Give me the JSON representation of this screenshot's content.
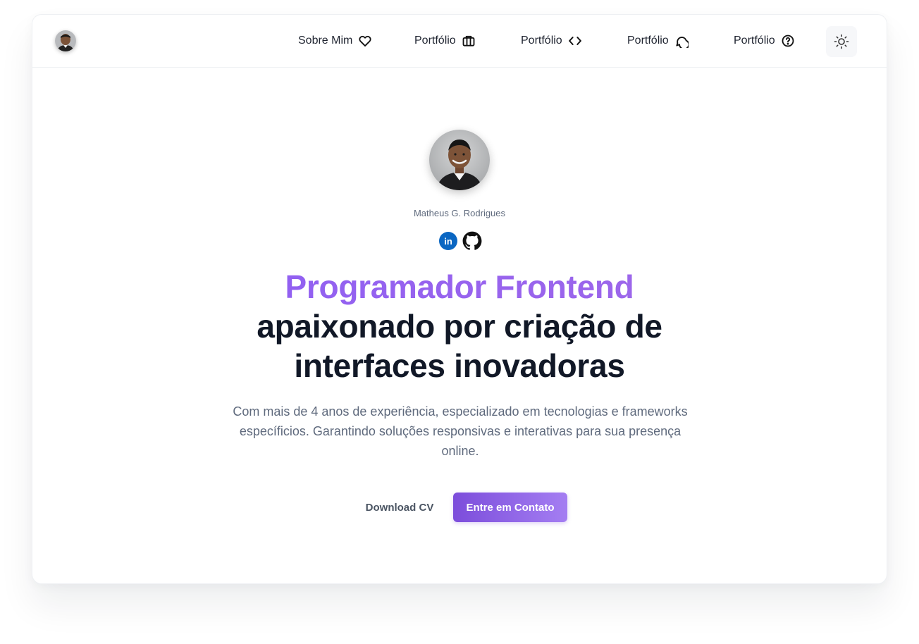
{
  "header": {
    "nav": [
      {
        "label": "Sobre Mim",
        "icon": "heart-icon"
      },
      {
        "label": "Portfólio",
        "icon": "briefcase-icon"
      },
      {
        "label": "Portfólio",
        "icon": "code-icon"
      },
      {
        "label": "Portfólio",
        "icon": "message-icon"
      },
      {
        "label": "Portfólio",
        "icon": "help-circle-icon"
      }
    ],
    "theme_toggle_icon": "sun-icon"
  },
  "profile": {
    "name": "Matheus G. Rodrigues",
    "socials": [
      {
        "name": "linkedin",
        "label": "in",
        "color": "#0a66c2"
      },
      {
        "name": "github",
        "color": "#111111"
      }
    ]
  },
  "hero": {
    "headline_accent": "Programador Frontend",
    "headline_line2": "apaixonado por criação de",
    "headline_line3": "interfaces inovadoras",
    "description": "Com mais de 4 anos de experiência, especializado em tecnologias e frameworks específicios. Garantindo soluções responsivas e interativas para sua presença online."
  },
  "actions": {
    "download_label": "Download CV",
    "contact_label": "Entre em Contato"
  },
  "colors": {
    "accent": "#8b5cf6",
    "text_dark": "#111827",
    "text_muted": "#5f6a7d"
  }
}
